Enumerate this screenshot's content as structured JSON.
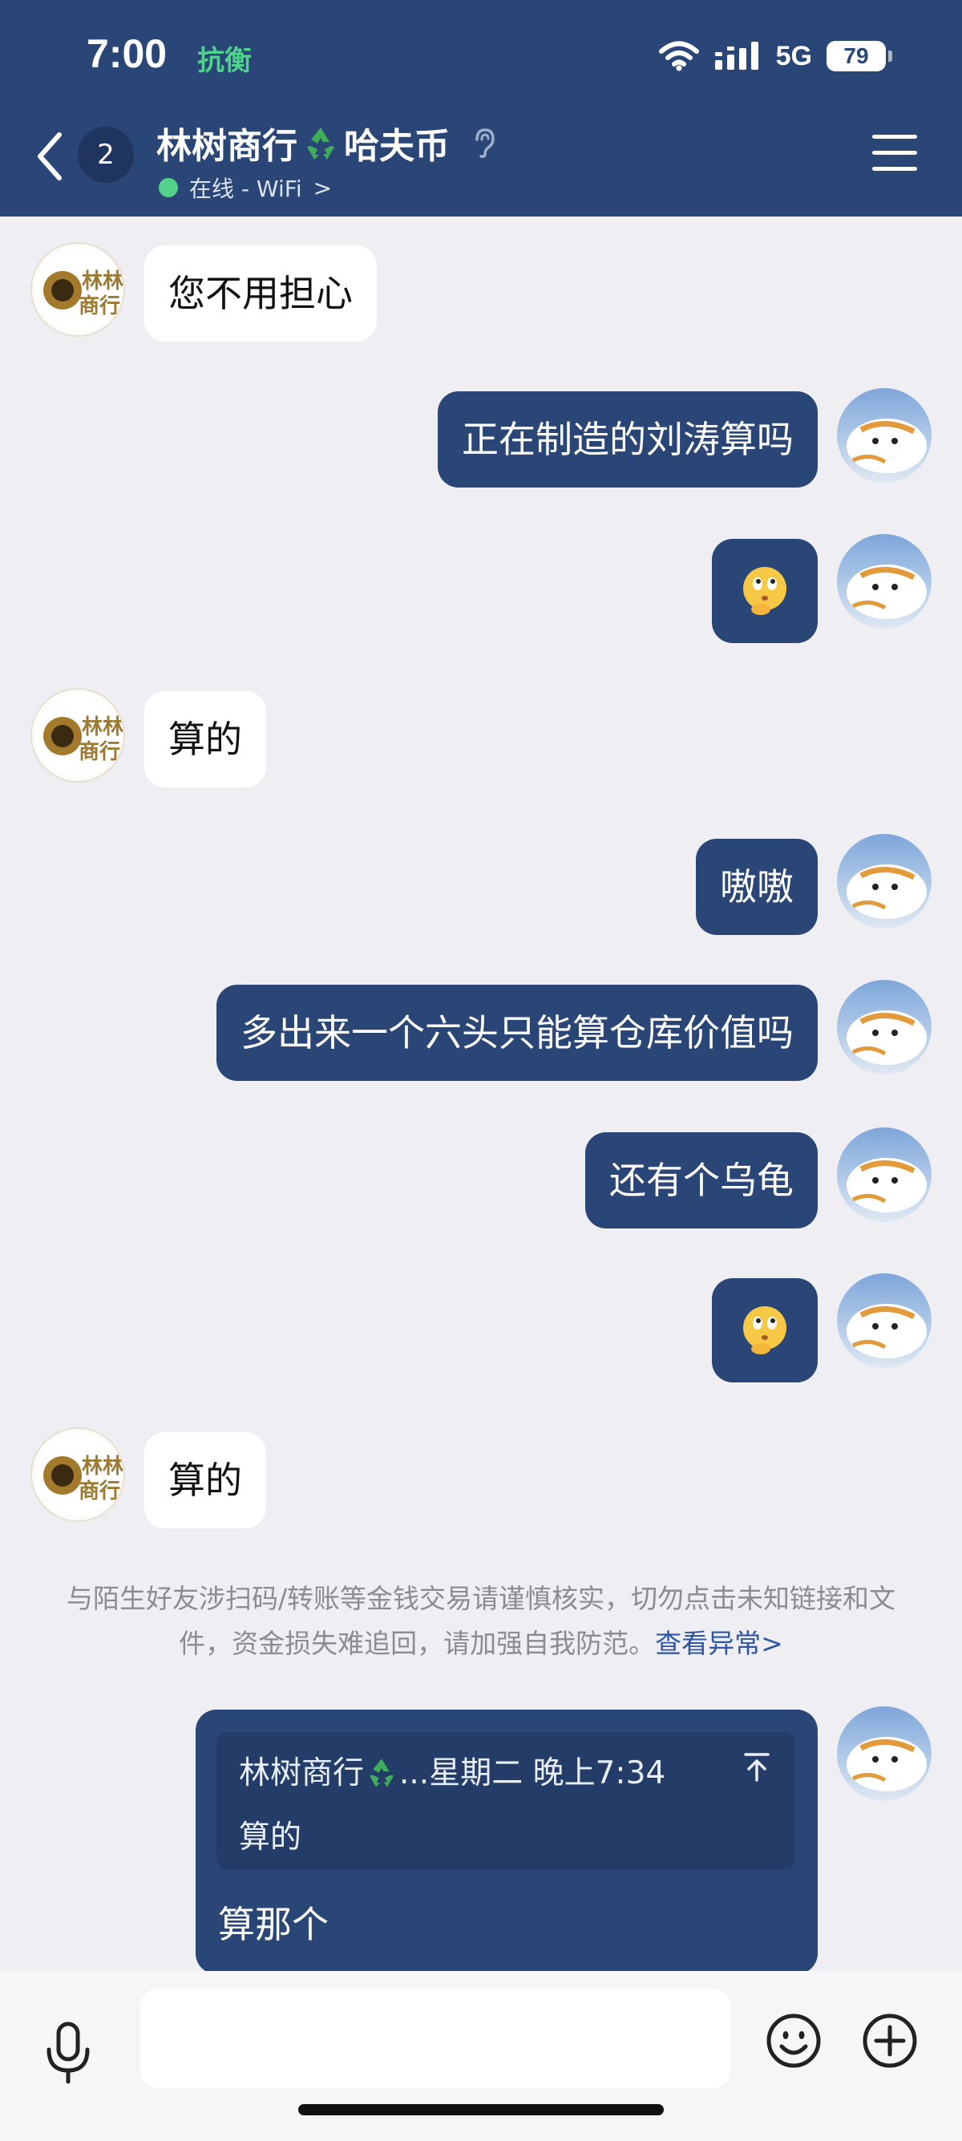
{
  "status_bar": {
    "time": "7:00",
    "tag": "抗衡",
    "network": "5G",
    "battery": "79"
  },
  "header": {
    "unread_count": "2",
    "title_part1": "林树商行",
    "title_part2": "哈夫币",
    "status": "在线 - WiFi",
    "status_chevron": ">"
  },
  "messages": [
    {
      "side": "in",
      "text": "您不用担心"
    },
    {
      "side": "out",
      "text": "正在制造的刘涛算吗"
    },
    {
      "side": "out",
      "type": "emoji",
      "icon": "thinking-emoji"
    },
    {
      "side": "in",
      "text": "算的"
    },
    {
      "side": "out",
      "text": "嗷嗷"
    },
    {
      "side": "out",
      "text": "多出来一个六头只能算仓库价值吗"
    },
    {
      "side": "out",
      "text": "还有个乌龟"
    },
    {
      "side": "out",
      "type": "emoji",
      "icon": "thinking-emoji"
    },
    {
      "side": "in",
      "text": "算的"
    }
  ],
  "notice": {
    "text": "与陌生好友涉扫码/转账等金钱交易请谨慎核实，切勿点击未知链接和文件，资金损失难追回，请加强自我防范。",
    "link": "查看异常>"
  },
  "quoted_reply": {
    "quote_sender": "林树商行",
    "quote_sender_suffix": "...",
    "quote_time": "星期二 晚上7:34",
    "quote_text": "算的",
    "reply_text": "算那个"
  },
  "colors": {
    "header_bg": "#2a4676",
    "outgoing_bubble": "#2a4676",
    "incoming_bubble": "#ffffff",
    "chat_bg": "#efeff3",
    "online": "#52d28a",
    "link": "#2f56a5"
  }
}
